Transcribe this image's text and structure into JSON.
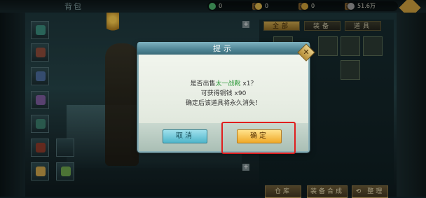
{
  "topbar": {
    "title": "背包",
    "currencies": [
      {
        "name": "jade",
        "value": "0",
        "color": "#4caf6a"
      },
      {
        "name": "ingot",
        "value": "0",
        "color": "#d8b24a"
      },
      {
        "name": "bound-ingot",
        "value": "0",
        "color": "#c69a36"
      },
      {
        "name": "copper",
        "value": "51.6万",
        "color": "#9a9a9a"
      }
    ]
  },
  "bag": {
    "tabs": [
      "全部",
      "装备",
      "道具"
    ],
    "buttons": {
      "warehouse": "仓库",
      "equip_box": "装备合成",
      "tidy": "整理"
    }
  },
  "dialog": {
    "title": "提示",
    "line1_prefix": "是否出售",
    "line1_item": "太一战靴",
    "line1_suffix": " x1？",
    "line2": "可获得铜钱 x90",
    "line3": "确定后该道具将永久消失！",
    "cancel": "取消",
    "confirm": "确定",
    "close": "✕"
  },
  "colors": {
    "highlight": "#2f9a3b",
    "annotation": "#e01e1e"
  }
}
